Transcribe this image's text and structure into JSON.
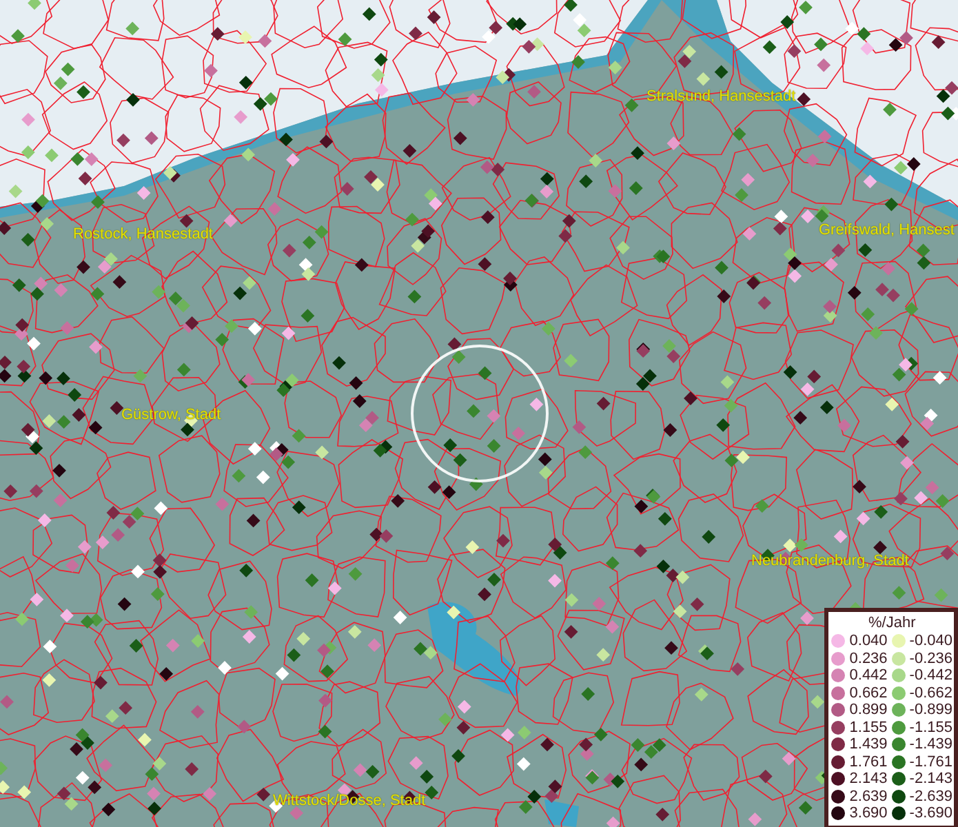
{
  "map": {
    "places": [
      {
        "label": "Stralsund, Hansestadt"
      },
      {
        "label": "Rostock, Hansestadt"
      },
      {
        "label": "Greifswald, Hansest"
      },
      {
        "label": "Güstrow, Stadt"
      },
      {
        "label": "Neubrandenburg, Stadt"
      },
      {
        "label": "Wittstock/Dosse, Stadt"
      }
    ]
  },
  "legend": {
    "title": "%/Jahr",
    "positive": [
      {
        "value": "0.040",
        "color": "#f5b8e6"
      },
      {
        "value": "0.236",
        "color": "#e79ccc"
      },
      {
        "value": "0.442",
        "color": "#d583b3"
      },
      {
        "value": "0.662",
        "color": "#c7709d"
      },
      {
        "value": "0.899",
        "color": "#b25a85"
      },
      {
        "value": "1.155",
        "color": "#963e60"
      },
      {
        "value": "1.439",
        "color": "#7f2a46"
      },
      {
        "value": "1.761",
        "color": "#661c33"
      },
      {
        "value": "2.143",
        "color": "#4d1024"
      },
      {
        "value": "2.639",
        "color": "#360a18"
      },
      {
        "value": "3.690",
        "color": "#240510"
      }
    ],
    "negative": [
      {
        "value": "-0.040",
        "color": "#e8f5b0"
      },
      {
        "value": "-0.236",
        "color": "#c8e6a0"
      },
      {
        "value": "-0.442",
        "color": "#a8d88a"
      },
      {
        "value": "-0.662",
        "color": "#8ccb72"
      },
      {
        "value": "-0.899",
        "color": "#6db35a"
      },
      {
        "value": "-1.155",
        "color": "#4e9a3e"
      },
      {
        "value": "-1.439",
        "color": "#3a862f"
      },
      {
        "value": "-1.761",
        "color": "#2a7423"
      },
      {
        "value": "-2.143",
        "color": "#1b5e18"
      },
      {
        "value": "-2.639",
        "color": "#0f4810"
      },
      {
        "value": "-3.690",
        "color": "#06300a"
      }
    ]
  }
}
